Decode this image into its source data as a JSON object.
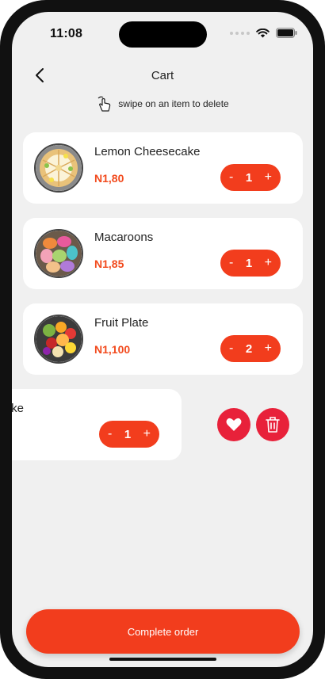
{
  "status": {
    "time": "11:08"
  },
  "header": {
    "title": "Cart",
    "swipe_hint": "swipe on an item to delete"
  },
  "items": [
    {
      "name": "Lemon Cheesecake",
      "price": "N1,80",
      "qty": "1",
      "minus": "-",
      "plus": "+"
    },
    {
      "name": "Macaroons",
      "price": "N1,85",
      "qty": "1",
      "minus": "-",
      "plus": "+"
    },
    {
      "name": "Fruit Plate",
      "price": "N1,100",
      "qty": "2",
      "minus": "-",
      "plus": "+"
    },
    {
      "name": "Cake",
      "qty": "1",
      "minus": "-",
      "plus": "+"
    }
  ],
  "footer": {
    "complete_label": "Complete order"
  },
  "colors": {
    "accent": "#f23d1d",
    "price": "#f24a1d",
    "action": "#e8213a",
    "background": "#f0f0f0"
  },
  "icons": {
    "back": "chevron-left-icon",
    "swipe": "swipe-hand-icon",
    "favorite": "heart-icon",
    "delete": "trash-icon"
  }
}
